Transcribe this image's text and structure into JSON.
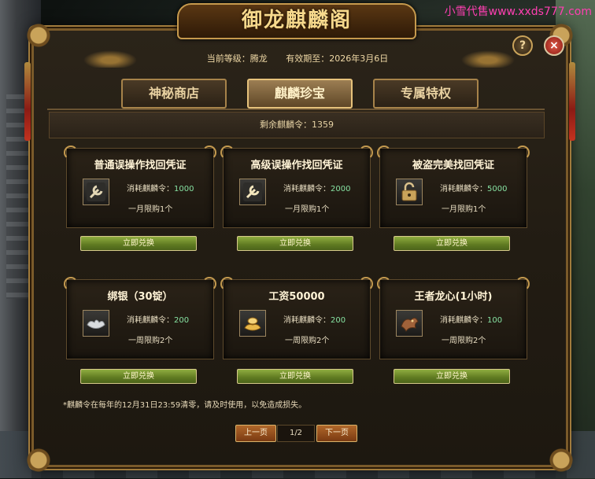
{
  "watermark": "小雪代售www.xxds777.com",
  "window": {
    "title": "御龙麒麟阁",
    "help_label": "?",
    "close_label": "×"
  },
  "info": {
    "level_text": "当前等级：腾龙",
    "expiry_text": "有效期至：2026年3月6日"
  },
  "tabs": [
    {
      "label": "神秘商店",
      "active": false
    },
    {
      "label": "麒麟珍宝",
      "active": true
    },
    {
      "label": "专属特权",
      "active": false
    }
  ],
  "remaining": "剩余麒麟令：1359",
  "cost_prefix": "消耗麒麟令：",
  "items": [
    {
      "title": "普通误操作找回凭证",
      "cost": "1000",
      "limit": "一月限购1个",
      "button": "立即兑换",
      "icon": "wrench-icon"
    },
    {
      "title": "高级误操作找回凭证",
      "cost": "2000",
      "limit": "一月限购1个",
      "button": "立即兑换",
      "icon": "wrench-icon"
    },
    {
      "title": "被盗完美找回凭证",
      "cost": "5000",
      "limit": "一月限购1个",
      "button": "立即兑换",
      "icon": "lock-icon"
    },
    {
      "title": "绑银（30锭）",
      "cost": "200",
      "limit": "一周限购2个",
      "button": "立即兑换",
      "icon": "silver-ingot-icon"
    },
    {
      "title": "工资50000",
      "cost": "200",
      "limit": "一周限购2个",
      "button": "立即兑换",
      "icon": "gold-ingot-icon"
    },
    {
      "title": "王者龙心(1小时)",
      "cost": "100",
      "limit": "一周限购2个",
      "button": "立即兑换",
      "icon": "dragon-heart-icon"
    }
  ],
  "note": "*麒麟令在每年的12月31日23:59清零，请及时使用，以免造成损失。",
  "pager": {
    "prev": "上一页",
    "page": "1/2",
    "next": "下一页"
  },
  "colors": {
    "accent_gold": "#c9a35a",
    "button_green": "#6f8c2b",
    "cost_green": "#86e0a1",
    "watermark_pink": "#ff3fb2"
  }
}
